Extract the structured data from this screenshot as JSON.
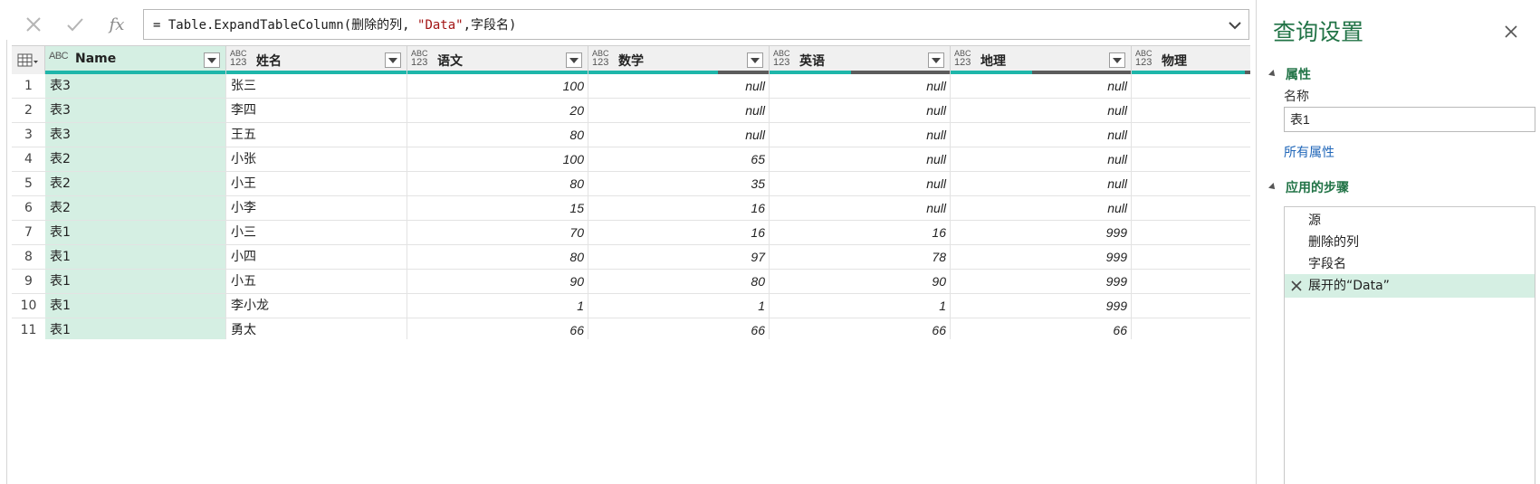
{
  "formula_bar": {
    "cancel_icon": "x-icon",
    "commit_icon": "check-icon",
    "fx_label": "fx",
    "formula_prefix": "= Table.ExpandTableColumn(删除的列, ",
    "formula_string": "\"Data\"",
    "formula_suffix": ",字段名)"
  },
  "grid": {
    "columns": [
      {
        "name": "Name",
        "type": "ABC"
      },
      {
        "name": "姓名",
        "type": "ABC123"
      },
      {
        "name": "语文",
        "type": "ABC123"
      },
      {
        "name": "数学",
        "type": "ABC123"
      },
      {
        "name": "英语",
        "type": "ABC123"
      },
      {
        "name": "地理",
        "type": "ABC123"
      },
      {
        "name": "物理",
        "type": "ABC123"
      }
    ],
    "type_labels": {
      "abc": "ABC",
      "abc123_top": "ABC",
      "abc123_bottom": "123"
    },
    "row_numbers": [
      "1",
      "2",
      "3",
      "4",
      "5",
      "6",
      "7",
      "8",
      "9",
      "10",
      "11"
    ],
    "rows": [
      [
        "表3",
        "张三",
        "100",
        "null",
        "null",
        "null",
        ""
      ],
      [
        "表3",
        "李四",
        "20",
        "null",
        "null",
        "null",
        ""
      ],
      [
        "表3",
        "王五",
        "80",
        "null",
        "null",
        "null",
        ""
      ],
      [
        "表2",
        "小张",
        "100",
        "65",
        "null",
        "null",
        ""
      ],
      [
        "表2",
        "小王",
        "80",
        "35",
        "null",
        "null",
        ""
      ],
      [
        "表2",
        "小李",
        "15",
        "16",
        "null",
        "null",
        ""
      ],
      [
        "表1",
        "小三",
        "70",
        "16",
        "16",
        "999",
        ""
      ],
      [
        "表1",
        "小四",
        "80",
        "97",
        "78",
        "999",
        ""
      ],
      [
        "表1",
        "小五",
        "90",
        "80",
        "90",
        "999",
        ""
      ],
      [
        "表1",
        "李小龙",
        "1",
        "1",
        "1",
        "999",
        ""
      ],
      [
        "表1",
        "勇太",
        "66",
        "66",
        "66",
        "66",
        ""
      ]
    ],
    "quality_valid_fraction": [
      1.0,
      1.0,
      1.0,
      0.72,
      0.45,
      0.45,
      0.9
    ]
  },
  "panel": {
    "title": "查询设置",
    "properties_header": "属性",
    "name_label": "名称",
    "name_value": "表1",
    "all_properties_link": "所有属性",
    "steps_header": "应用的步骤",
    "steps": [
      "源",
      "删除的列",
      "字段名",
      "展开的“Data”"
    ],
    "active_step": 3
  },
  "colors": {
    "accent_green": "#217346",
    "selection_bg": "#d5efe3",
    "quality_valid": "#1eb6aa",
    "quality_empty": "#5c5c5c",
    "link_blue": "#2167b9",
    "formula_string": "#a31515"
  }
}
